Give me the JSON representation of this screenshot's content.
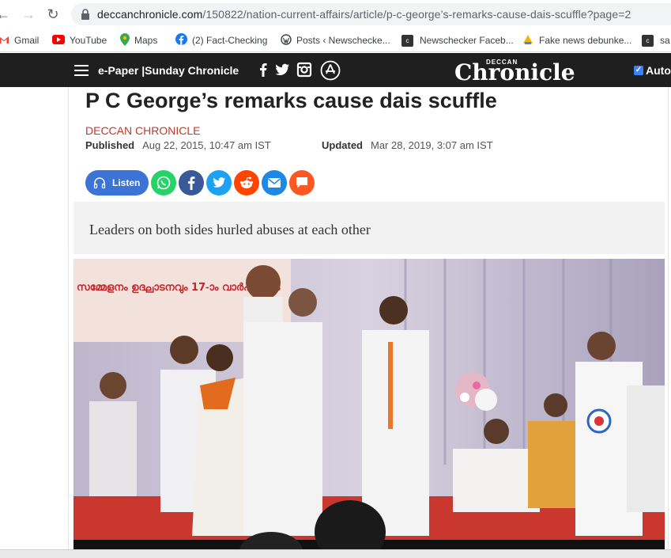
{
  "browser": {
    "url_host": "deccanchronicle.com",
    "url_path": "/150822/nation-current-affairs/article/p-c-george’s-remarks-cause-dais-scuffle?page=2"
  },
  "bookmarks": [
    {
      "label": "Gmail",
      "icon": "gmail-icon",
      "color": "#ea4335"
    },
    {
      "label": "YouTube",
      "icon": "youtube-icon",
      "color": "#ff0000"
    },
    {
      "label": "Maps",
      "icon": "maps-icon",
      "color": "#34a853"
    },
    {
      "label": "(2) Fact-Checking",
      "icon": "facebook-icon",
      "color": "#1877f2"
    },
    {
      "label": "Posts ‹ Newschecke...",
      "icon": "wordpress-icon",
      "color": "#3c4043"
    },
    {
      "label": "Newschecker Faceb...",
      "icon": "newschecker-icon",
      "color": "#333333"
    },
    {
      "label": "Fake news debunke...",
      "icon": "debunker-icon",
      "color": "#f4b400"
    },
    {
      "label": "sa",
      "icon": "newschecker-icon-2",
      "color": "#333333"
    }
  ],
  "site": {
    "epaper_label": "e-Paper |Sunday Chronicle",
    "brand_small": "DECCAN",
    "brand_big": "Chronicle",
    "auto_label": "Auto"
  },
  "article": {
    "headline": "P C George’s remarks cause dais scuffle",
    "source": "DECCAN CHRONICLE",
    "published_label": "Published",
    "published_value": "Aug 22, 2015, 10:47 am IST",
    "updated_label": "Updated",
    "updated_value": "Mar 28, 2019, 3:07 am IST",
    "listen_label": "Listen",
    "summary": "Leaders on both sides hurled abuses at each other",
    "photo_banner_text": "സമ്മേളനം ഉദ്ഘാടനവും 17-ാം വാർഷികവും"
  },
  "colors": {
    "site_bar": "#1f1f1f",
    "source_red": "#c0392b",
    "listen_blue": "#3b73d6",
    "whatsapp": "#25d366",
    "facebook": "#3b5998",
    "twitter": "#1da1f2",
    "reddit": "#ff4500",
    "email": "#1e88e5",
    "comment": "#ff5722"
  }
}
